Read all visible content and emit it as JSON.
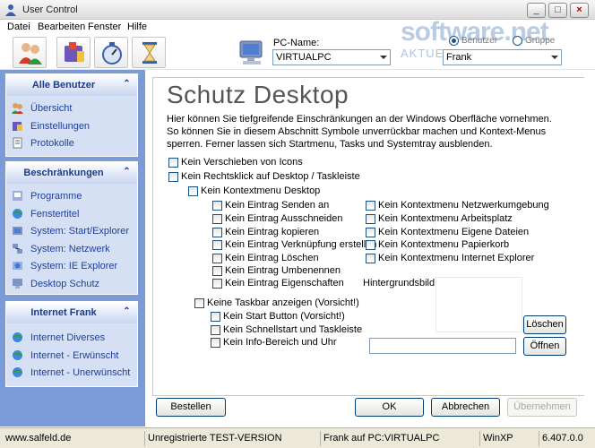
{
  "window": {
    "title": "User Control"
  },
  "menu": [
    "Datei",
    "Bearbeiten",
    "Fenster",
    "Hilfe"
  ],
  "pc": {
    "label": "PC-Name:",
    "value": "VIRTUALPC"
  },
  "scope": {
    "user_label": "Benutzer",
    "group_label": "Gruppe",
    "selected": "Benutzer",
    "user_value": "Frank"
  },
  "watermark": {
    "main": "software.net",
    "sub": "AKTUELLE DOWNLOADS"
  },
  "sidebar": {
    "panels": [
      {
        "title": "Alle Benutzer",
        "items": [
          {
            "label": "Übersicht",
            "icon": "overview-icon"
          },
          {
            "label": "Einstellungen",
            "icon": "settings-icon"
          },
          {
            "label": "Protokolle",
            "icon": "log-icon"
          }
        ]
      },
      {
        "title": "Beschränkungen",
        "items": [
          {
            "label": "Programme",
            "icon": "programs-icon"
          },
          {
            "label": "Fenstertitel",
            "icon": "window-title-icon"
          },
          {
            "label": "System: Start/Explorer",
            "icon": "start-explorer-icon"
          },
          {
            "label": "System: Netzwerk",
            "icon": "network-icon"
          },
          {
            "label": "System: IE Explorer",
            "icon": "ie-icon"
          },
          {
            "label": "Desktop Schutz",
            "icon": "desktop-icon"
          }
        ]
      },
      {
        "title": "Internet Frank",
        "items": [
          {
            "label": "Internet Diverses",
            "icon": "internet-icon"
          },
          {
            "label": "Internet - Erwünscht",
            "icon": "internet-allowed-icon"
          },
          {
            "label": "Internet - Unerwünscht",
            "icon": "internet-blocked-icon"
          }
        ]
      }
    ]
  },
  "main": {
    "title": "Schutz Desktop",
    "description": "Hier können Sie tiefgreifende Einschränkungen an der Windows Oberfläche vornehmen. So können Sie in diesem Abschnitt Symbole unverrückbar machen und Kontext-Menus sperren. Ferner lassen sich Startmenu, Tasks und Systemtray ausblenden.",
    "options": {
      "no_move_icons": "Kein Verschieben von Icons",
      "no_rightclick": "Kein Rechtsklick auf Desktop / Taskleiste",
      "no_context_desktop": "Kein Kontextmenu Desktop",
      "entries_left": [
        "Kein Eintrag Senden an",
        "Kein Eintrag Ausschneiden",
        "Kein Eintrag kopieren",
        "Kein Eintrag Verknüpfung erstellen",
        "Kein Eintrag Löschen",
        "Kein Eintrag Umbenennen",
        "Kein Eintrag Eigenschaften"
      ],
      "entries_right": [
        "Kein Kontextmenu Netzwerkumgebung",
        "Kein Kontextmenu Arbeitsplatz",
        "Kein Kontextmenu Eigene Dateien",
        "Kein Kontextmenu Papierkorb",
        "Kein Kontextmenu Internet Explorer"
      ],
      "no_taskbar": "Keine Taskbar anzeigen (Vorsicht!)",
      "taskbar_sub": [
        "Kein Start Button (Vorsicht!)",
        "Kein Schnellstart und Taskleiste",
        "Kein Info-Bereich und Uhr"
      ]
    },
    "background_label": "Hintergrundsbild:",
    "buttons": {
      "delete": "Löschen",
      "open": "Öffnen",
      "order": "Bestellen",
      "ok": "OK",
      "cancel": "Abbrechen",
      "apply": "Übernehmen"
    }
  },
  "status": {
    "site": "www.salfeld.de",
    "license": "Unregistrierte TEST-VERSION",
    "user": "Frank auf PC:VIRTUALPC",
    "os": "WinXP",
    "version": "6.407.0.0"
  }
}
